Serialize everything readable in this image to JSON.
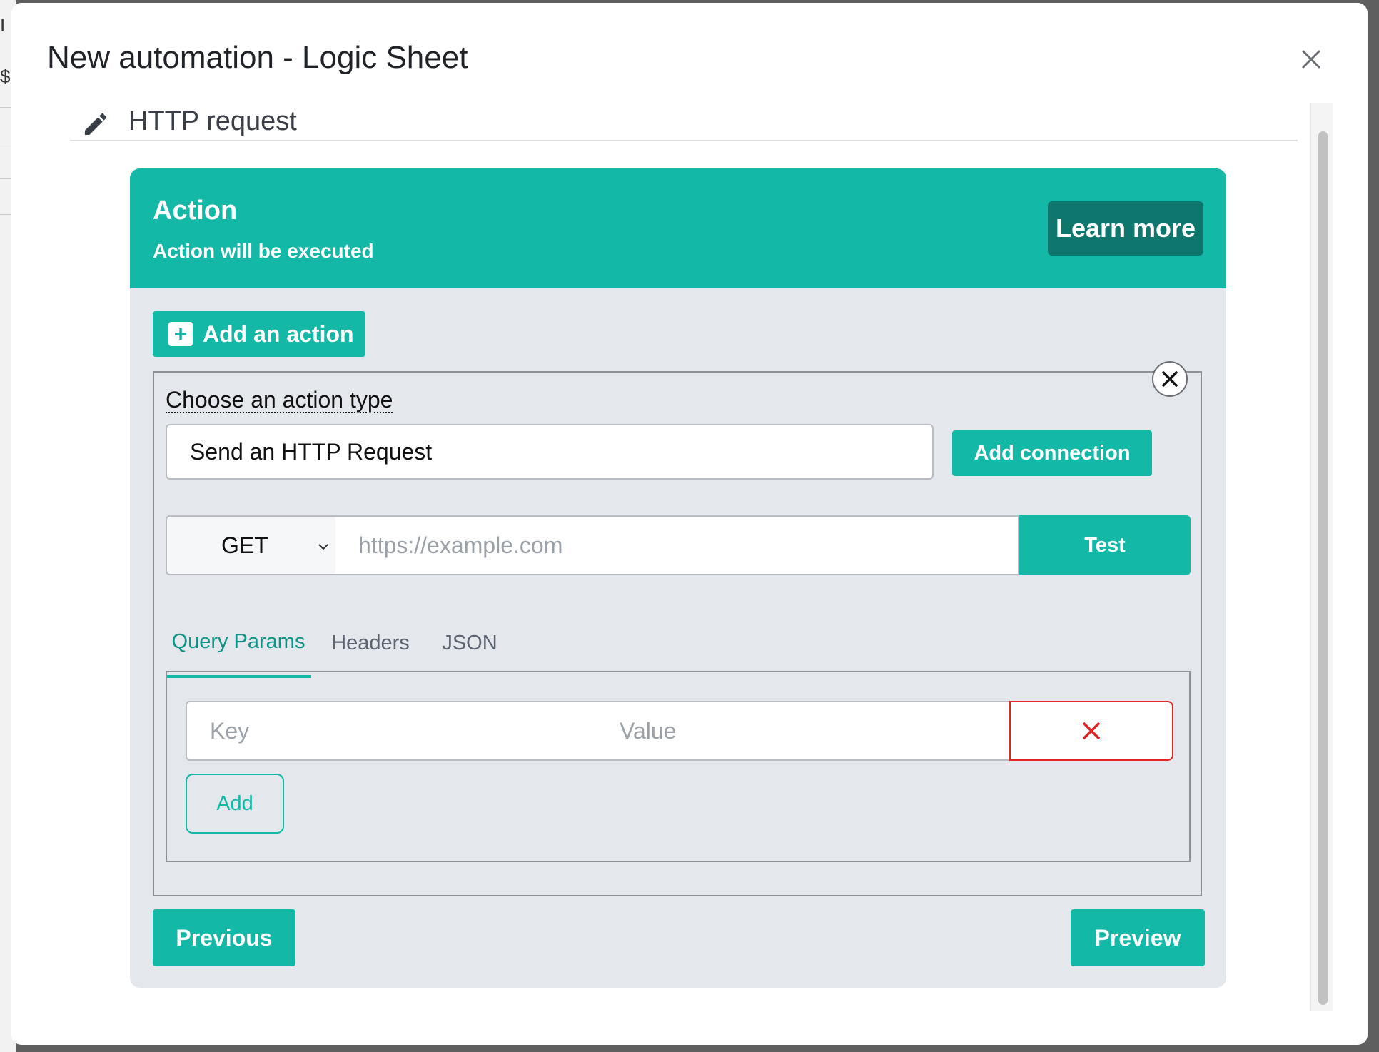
{
  "background": {
    "glyphs": [
      "I",
      "$"
    ]
  },
  "modal": {
    "title": "New automation - Logic Sheet",
    "close_icon": "close-icon"
  },
  "section": {
    "icon": "pencil-icon",
    "title": "HTTP request"
  },
  "action_card": {
    "title": "Action",
    "subtitle": "Action will be executed",
    "learn_more_label": "Learn more",
    "add_action_label": "Add an action",
    "type_label": "Choose an action type",
    "type_value": "Send an HTTP Request",
    "add_connection_label": "Add connection",
    "request": {
      "method": "GET",
      "url_placeholder": "https://example.com",
      "test_label": "Test"
    },
    "tabs": [
      {
        "label": "Query Params",
        "active": true
      },
      {
        "label": "Headers",
        "active": false
      },
      {
        "label": "JSON",
        "active": false
      }
    ],
    "params": {
      "key_placeholder": "Key",
      "value_placeholder": "Value",
      "add_label": "Add"
    },
    "previous_label": "Previous",
    "preview_label": "Preview"
  },
  "colors": {
    "accent": "#14b8a6",
    "accent_dark": "#0f766e",
    "danger": "#e02424",
    "card_bg": "#e4e7eb",
    "overlay": "#5f5f5f"
  }
}
